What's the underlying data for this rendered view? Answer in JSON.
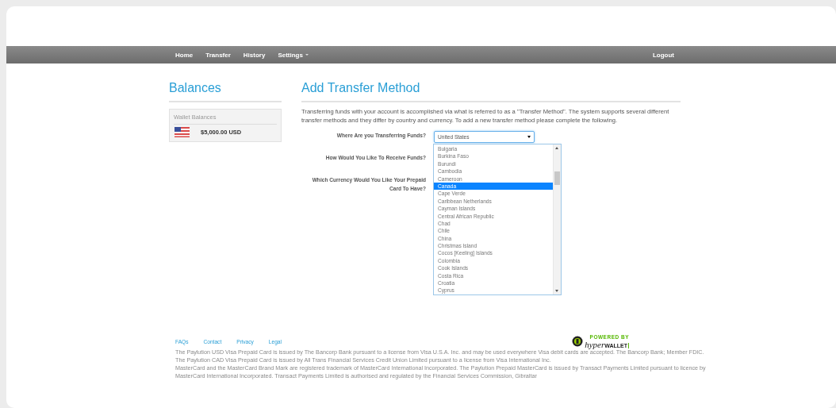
{
  "nav": {
    "items": [
      {
        "label": "Home"
      },
      {
        "label": "Transfer"
      },
      {
        "label": "History"
      },
      {
        "label": "Settings",
        "dropdown": true
      }
    ],
    "logout": "Logout"
  },
  "sidebar": {
    "title": "Balances",
    "panel_title": "Wallet Balances",
    "balances": [
      {
        "amount": "$5,000.00 USD"
      }
    ]
  },
  "main": {
    "title": "Add Transfer Method",
    "intro": "Transferring funds with your account is accomplished via what is referred to as a \"Transfer Method\". The system supports several different transfer methods and they differ by country and currency. To add a new transfer method please complete the following.",
    "fields": [
      {
        "kind": "select",
        "label": "Where Are you Transferring Funds?",
        "value": "United States",
        "expanded": true
      },
      {
        "kind": "label",
        "label": "How Would You Like To Receive Funds?"
      },
      {
        "kind": "label",
        "label": "Which Currency Would You Like Your Prepaid Card To Have?"
      }
    ],
    "options": [
      {
        "label": "Bulgaria",
        "selected": false
      },
      {
        "label": "Burkina Faso",
        "selected": false
      },
      {
        "label": "Burundi",
        "selected": false
      },
      {
        "label": "Cambodia",
        "selected": false
      },
      {
        "label": "Cameroon",
        "selected": false
      },
      {
        "label": "Canada",
        "selected": true
      },
      {
        "label": "Cape Verde",
        "selected": false
      },
      {
        "label": "Caribbean Netherlands",
        "selected": false
      },
      {
        "label": "Cayman Islands",
        "selected": false
      },
      {
        "label": "Central African Republic",
        "selected": false
      },
      {
        "label": "Chad",
        "selected": false
      },
      {
        "label": "Chile",
        "selected": false
      },
      {
        "label": "China",
        "selected": false
      },
      {
        "label": "Christmas Island",
        "selected": false
      },
      {
        "label": "Cocos [Keeling] Islands",
        "selected": false
      },
      {
        "label": "Colombia",
        "selected": false
      },
      {
        "label": "Cook Islands",
        "selected": false
      },
      {
        "label": "Costa Rica",
        "selected": false
      },
      {
        "label": "Croatia",
        "selected": false
      },
      {
        "label": "Cyprus",
        "selected": false
      }
    ]
  },
  "footer": {
    "links": [
      "FAQs",
      "Contact",
      "Privacy",
      "Legal"
    ],
    "badge": {
      "top": "POWERED BY",
      "brand": "hyper",
      "brand_bold": "WALLET"
    },
    "legal": [
      "The Paylution USD Visa Prepaid Card is issued by The Bancorp Bank pursuant to a license from Visa U.S.A. Inc. and may be used everywhere Visa debit cards are accepted. The Bancorp Bank; Member FDIC.",
      "The Paylution CAD Visa Prepaid Card is issued by All Trans Financial Services Credit Union Limited pursuant to a license from Visa International Inc.",
      "MasterCard and the MasterCard Brand Mark are registered trademark of MasterCard International Incorporated. The Paylution Prepaid MasterCard is issued by Transact Payments Limited pursuant to licence by MasterCard International Incorporated. Transact Payments Limited is authorised and regulated by the Financial Services Commission, Gibraltar"
    ]
  }
}
